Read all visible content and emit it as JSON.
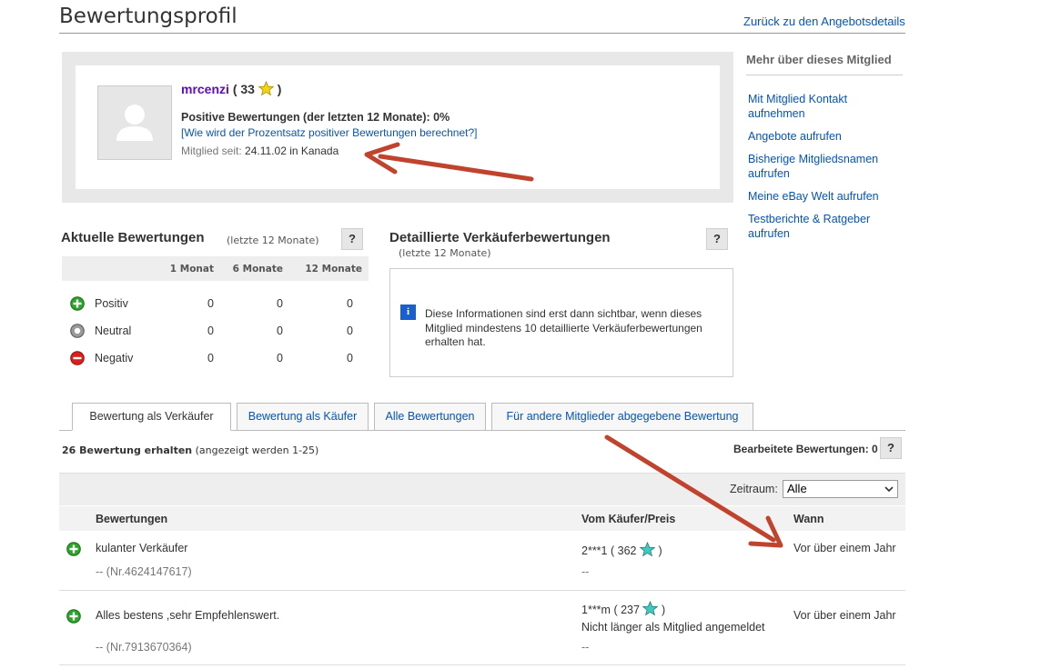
{
  "header": {
    "title": "Bewertungsprofil",
    "back_link": "Zurück zu den Angebotsdetails"
  },
  "profile": {
    "username": "mrcenzi",
    "score_open": "(",
    "score": "33",
    "score_close": ")",
    "positive_feedback": "Positive Bewertungen (der letzten 12 Monate): 0%",
    "how_calculated_link": "[Wie wird der Prozentsatz positiver Bewertungen berechnet?]",
    "member_since_label": "Mitglied seit:",
    "member_since_value": "24.11.02 in Kanada",
    "star_color": "#f5d40a"
  },
  "sidebar": {
    "title": "Mehr über dieses Mitglied",
    "links": [
      "Mit Mitglied Kontakt aufnehmen",
      "Angebote aufrufen",
      "Bisherige Mitgliedsnamen aufrufen",
      "Meine eBay Welt aufrufen",
      "Testberichte & Ratgeber aufrufen"
    ]
  },
  "current_ratings": {
    "title": "Aktuelle Bewertungen",
    "subtitle": "(letzte 12 Monate)",
    "help": "?",
    "columns": [
      "1 Monat",
      "6 Monate",
      "12 Monate"
    ],
    "rows": [
      {
        "label": "Positiv",
        "icon": "positive-icon",
        "values": [
          "0",
          "0",
          "0"
        ]
      },
      {
        "label": "Neutral",
        "icon": "neutral-icon",
        "values": [
          "0",
          "0",
          "0"
        ]
      },
      {
        "label": "Negativ",
        "icon": "negative-icon",
        "values": [
          "0",
          "0",
          "0"
        ]
      }
    ]
  },
  "dsr": {
    "title": "Detaillierte Verkäuferbewertungen",
    "subtitle": "(letzte 12 Monate)",
    "help": "?",
    "info_icon": "i",
    "info_text": "Diese Informationen sind erst dann sichtbar, wenn dieses Mitglied mindestens 10 detaillierte Verkäuferbewertungen erhalten hat."
  },
  "tabs": [
    {
      "label": "Bewertung als Verkäufer",
      "active": true
    },
    {
      "label": "Bewertung als Käufer",
      "active": false
    },
    {
      "label": "Alle Bewertungen",
      "active": false
    },
    {
      "label": "Für andere Mitglieder abgegebene Bewertung",
      "active": false
    }
  ],
  "summary": {
    "received": "26 Bewertung erhalten",
    "shown": "(angezeigt werden 1-25)",
    "edited": "Bearbeitete Bewertungen: 0",
    "help": "?"
  },
  "filter": {
    "label": "Zeitraum:",
    "selected": "Alle"
  },
  "table": {
    "headers": [
      "Bewertungen",
      "Vom Käufer/Preis",
      "Wann"
    ],
    "rows": [
      {
        "comment": "kulanter Verkäufer",
        "item": "-- (Nr.4624147617)",
        "buyer": "2***1",
        "buyer_score_open": "(",
        "buyer_score": "362",
        "buyer_score_close": ")",
        "buyer_note": "",
        "price": "--",
        "when": "Vor über einem Jahr"
      },
      {
        "comment": "Alles bestens ,sehr Empfehlenswert.",
        "item": "-- (Nr.7913670364)",
        "buyer": "1***m",
        "buyer_score_open": "(",
        "buyer_score": "237",
        "buyer_score_close": ")",
        "buyer_note": "Nicht länger als Mitglied angemeldet",
        "price": "--",
        "when": "Vor über einem Jahr"
      }
    ],
    "star_color": "#3fc9c0"
  },
  "colors": {
    "link": "#0654ba",
    "username": "#5e0bbf",
    "annotation_arrow": "#c0432e",
    "positive": "#2aa52a",
    "negative": "#d9201c"
  }
}
